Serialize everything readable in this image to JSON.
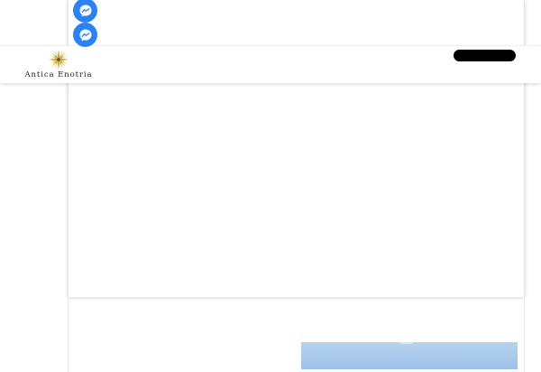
{
  "header": {
    "logo_text": "Antica Enotria",
    "menu_button_label": ""
  },
  "floating_buttons": [
    {
      "icon": "messenger-icon"
    },
    {
      "icon": "messenger-icon"
    }
  ],
  "colors": {
    "accent_blue": "#2a82f6",
    "logo_gold": "#c9a227",
    "header_pill": "#000000",
    "sky": "#a8c9ec"
  }
}
